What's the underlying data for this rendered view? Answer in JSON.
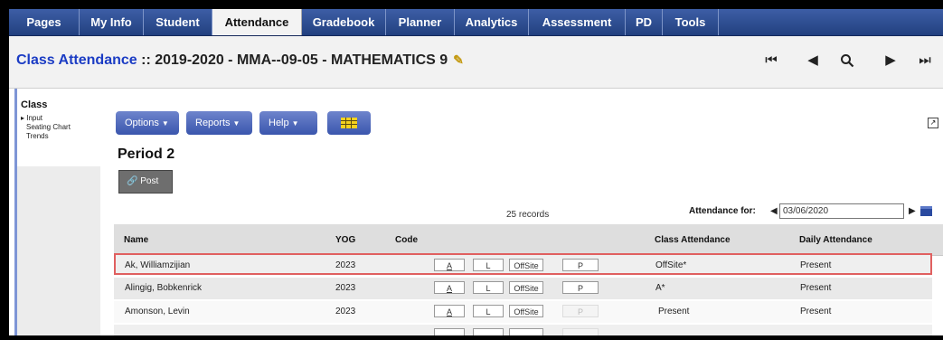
{
  "nav": {
    "tabs": [
      "Pages",
      "My Info",
      "Student",
      "Attendance",
      "Gradebook",
      "Planner",
      "Analytics",
      "Assessment",
      "PD",
      "Tools"
    ],
    "active": "Attendance"
  },
  "title": {
    "link": "Class Attendance",
    "rest": " :: 2019-2020 - MMA--09-05 - MATHEMATICS 9"
  },
  "sidebar": {
    "title": "Class",
    "items": [
      "▸ Input",
      "Seating Chart",
      "Trends"
    ]
  },
  "toolbar": {
    "options": "Options",
    "reports": "Reports",
    "help": "Help"
  },
  "period": "Period 2",
  "post_label": "Post",
  "records": "25 records",
  "attendance": {
    "label": "Attendance for:",
    "date": "03/06/2020"
  },
  "table": {
    "headers": {
      "name": "Name",
      "yog": "YOG",
      "code": "Code",
      "class": "Class Attendance",
      "daily": "Daily Attendance"
    },
    "code_labels": {
      "a": "A",
      "l": "L",
      "offsite": "OffSite",
      "p": "P"
    },
    "rows": [
      {
        "name": "Ak, Williamzijian",
        "yog": "2023",
        "class": "OffSite*",
        "daily": "Present"
      },
      {
        "name": "Alingig, Bobkenrick",
        "yog": "2023",
        "class": "A*",
        "daily": "Present"
      },
      {
        "name": "Amonson, Levin",
        "yog": "2023",
        "class": "Present",
        "daily": "Present"
      },
      {
        "name": "",
        "yog": "",
        "class": "",
        "daily": ""
      }
    ]
  }
}
